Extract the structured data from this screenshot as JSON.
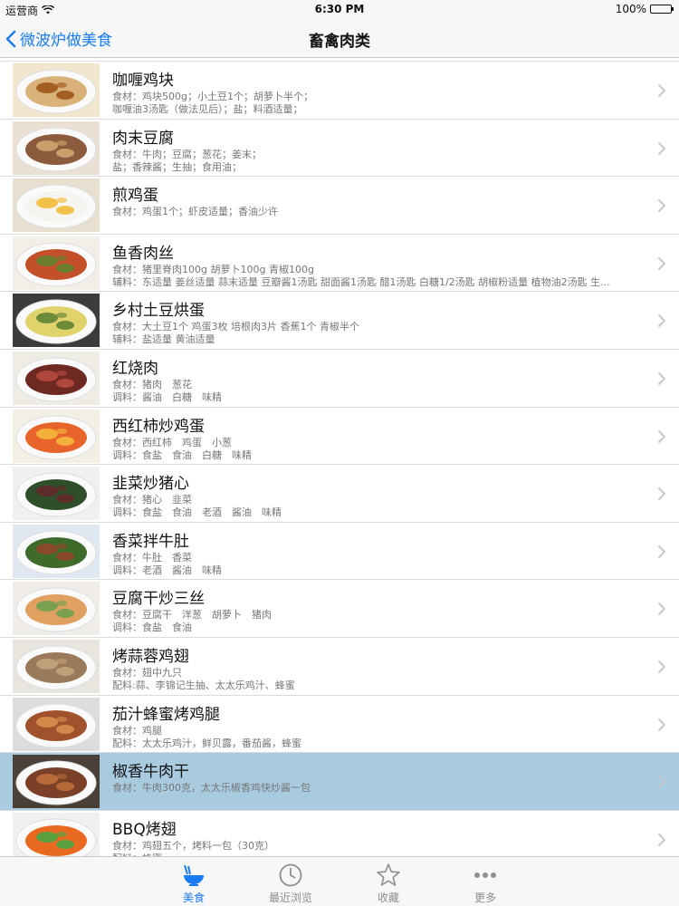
{
  "status_bar": {
    "carrier": "运营商",
    "time": "6:30 PM",
    "battery": "100%",
    "battery_level": 1.0
  },
  "nav": {
    "back_label": "微波炉做美食",
    "title": "畜禽肉类"
  },
  "rows": [
    {
      "title": "咖喱鸡块",
      "line1": "食材：鸡块500g；小土豆1个；胡萝卜半个；",
      "line2": "咖喱油3汤匙（做法见后）；盐；料酒适量；"
    },
    {
      "title": "肉末豆腐",
      "line1": "食材：牛肉；豆腐；葱花；姜末；",
      "line2": "盐；香辣酱；生抽；食用油；"
    },
    {
      "title": "煎鸡蛋",
      "line1": "食材：鸡蛋1个；虾皮适量；香油少许",
      "line2": ""
    },
    {
      "title": "鱼香肉丝",
      "line1": "食材：猪里脊肉100g 胡萝卜100g 青椒100g",
      "line2": "辅料：东适量 姜丝适量 蒜末适量 豆瓣酱1汤匙 甜面酱1汤匙 醋1汤匙 白糖1/2汤匙 胡椒粉适量 植物油2汤匙 生..."
    },
    {
      "title": "乡村土豆烘蛋",
      "line1": "食材：大土豆1个 鸡蛋3枚 培根肉3片 香蕉1个 青椒半个",
      "line2": "辅料：盐适量 黄油适量"
    },
    {
      "title": "红烧肉",
      "line1": "食材：猪肉　葱花",
      "line2": "调料：酱油　白糖　味精"
    },
    {
      "title": "西红柿炒鸡蛋",
      "line1": "食材：西红柿　鸡蛋　小葱",
      "line2": "调料：食盐　食油　白糖　味精"
    },
    {
      "title": "韭菜炒猪心",
      "line1": "食材：猪心　韭菜",
      "line2": "调料：食盐　食油　老酒　酱油　味精"
    },
    {
      "title": "香菜拌牛肚",
      "line1": "食材：牛肚　香菜",
      "line2": "调料：老酒　酱油　味精"
    },
    {
      "title": "豆腐干炒三丝",
      "line1": "食材：豆腐干　洋葱　胡萝卜　猪肉",
      "line2": "调料：食盐　食油"
    },
    {
      "title": "烤蒜蓉鸡翅",
      "line1": "食材：翅中九只",
      "line2": "配料:蒜、李锦记生抽、太太乐鸡汁、蜂蜜"
    },
    {
      "title": "茄汁蜂蜜烤鸡腿",
      "line1": "食材：鸡腿",
      "line2": "配料：太太乐鸡汁，鲜贝露，番茄酱，蜂蜜"
    },
    {
      "title": "椒香牛肉干",
      "line1": "食材：牛肉300克，太太乐椒香鸡快炒酱一包",
      "line2": ""
    },
    {
      "title": "BBQ烤翅",
      "line1": "食材：鸡翅五个，烤料一包（30克）",
      "line2": "配料：蜂蜜"
    }
  ],
  "tabs": [
    {
      "label": "美食",
      "icon": "bowl-icon"
    },
    {
      "label": "最近浏览",
      "icon": "clock-icon"
    },
    {
      "label": "收藏",
      "icon": "star-icon"
    },
    {
      "label": "更多",
      "icon": "more-dots-icon"
    }
  ],
  "colors": {
    "accent": "#1a7cf5",
    "highlight": "#a9cbe0",
    "inactive": "#8e8e93"
  }
}
